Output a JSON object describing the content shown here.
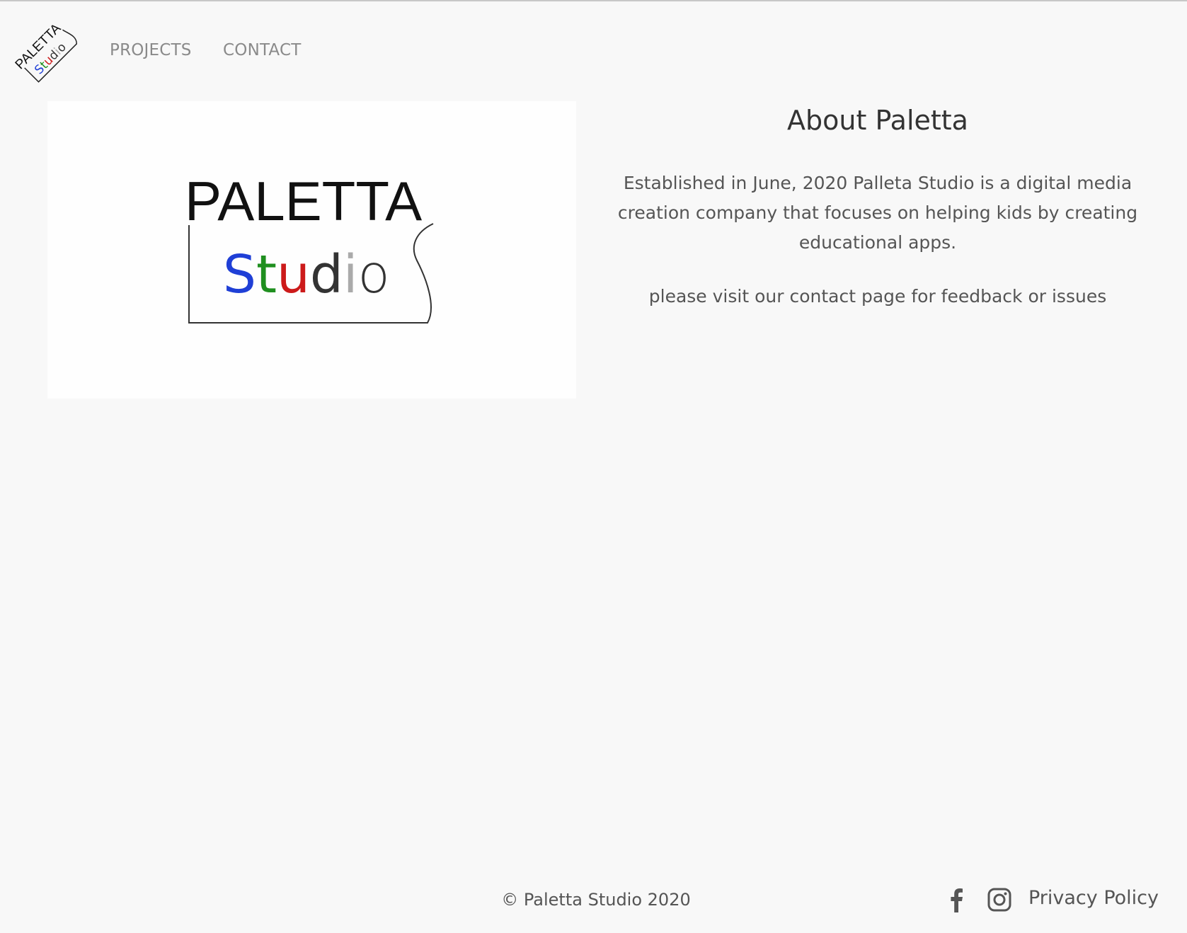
{
  "header": {
    "logo": {
      "text_top": "PALETTA",
      "text_bottom_letters": [
        "S",
        "t",
        "u",
        "d",
        "i",
        "o"
      ]
    },
    "nav": [
      {
        "label": "PROJECTS"
      },
      {
        "label": "CONTACT"
      }
    ]
  },
  "hero_image": {
    "title": "PALETTA",
    "subtitle_letters": [
      "S",
      "t",
      "u",
      "d",
      "i",
      "o"
    ],
    "letter_colors": [
      "#1f3fd6",
      "#1f8f1f",
      "#cc1a1a",
      "#333333",
      "#aaaaaa",
      "#333333"
    ]
  },
  "about": {
    "title": "About Paletta",
    "description": "Established in June, 2020 Palleta Studio is a digital media creation company that focuses on helping kids by creating educational apps.",
    "contact_note": "please visit our contact page for feedback or issues"
  },
  "footer": {
    "copyright": "© Paletta Studio 2020",
    "social": [
      {
        "icon": "facebook-icon"
      },
      {
        "icon": "instagram-icon"
      }
    ],
    "privacy_label": "Privacy Policy"
  },
  "colors": {
    "background": "#f8f8f8",
    "nav_text": "#8a8a8a",
    "body_text": "#555555",
    "heading_text": "#333333"
  }
}
